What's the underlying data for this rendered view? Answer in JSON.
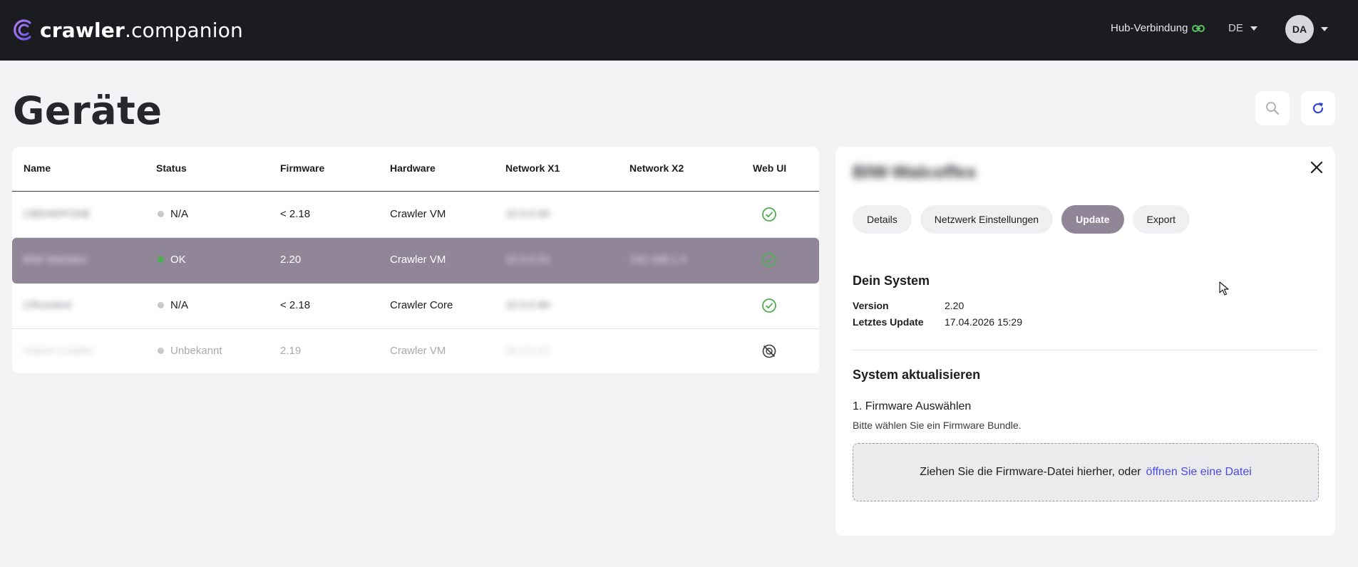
{
  "header": {
    "logo_bold": "crawler",
    "logo_rest": ".companion",
    "hub_label": "Hub-Verbindung",
    "language": "DE",
    "user_initials": "DA"
  },
  "page": {
    "title": "Geräte"
  },
  "table": {
    "columns": [
      "Name",
      "Status",
      "Firmware",
      "Hardware",
      "Network X1",
      "Network X2",
      "Web UI"
    ],
    "rows": [
      {
        "name": "CBDAEPONE",
        "status": "N/A",
        "firmware": "< 2.18",
        "hardware": "Crawler VM",
        "network_x1": "10.0.0.85",
        "network_x2": "",
        "web_ui": "available"
      },
      {
        "name": "BIW Markdoc",
        "status": "OK",
        "firmware": "2.20",
        "hardware": "Crawler VM",
        "network_x1": "10.0.0.91",
        "network_x2": "192.168.1.4",
        "web_ui": "available"
      },
      {
        "name": "CRcontrol",
        "status": "N/A",
        "firmware": "< 2.18",
        "hardware": "Crawler Core",
        "network_x1": "10.0.0.80",
        "network_x2": "",
        "web_ui": "available"
      },
      {
        "name": "Import Crawler",
        "status": "Unbekannt",
        "firmware": "2.19",
        "hardware": "Crawler VM",
        "network_x1": "10.0.0.21",
        "network_x2": "",
        "web_ui": "unavailable"
      }
    ]
  },
  "panel": {
    "device_name": "BIW-Walcoffex",
    "tabs": [
      "Details",
      "Netzwerk Einstellungen",
      "Update",
      "Export"
    ],
    "active_tab": "Update",
    "system_title": "Dein System",
    "version_label": "Version",
    "version_value": "2.20",
    "last_update_label": "Letztes Update",
    "last_update_value": "17.04.2026 15:29",
    "update_title": "System aktualisieren",
    "step_title": "1. Firmware Auswählen",
    "step_subtitle": "Bitte wählen Sie ein Firmware Bundle.",
    "drop_text": "Ziehen Sie die Firmware-Datei hierher, oder",
    "drop_link": "öffnen Sie eine Datei"
  },
  "colors": {
    "header_bg": "#1b1c20",
    "accent": "#908698",
    "ok": "#4caf50",
    "na": "#c8c8cc",
    "link": "#4a4ae0",
    "refresh": "#2f43d6"
  }
}
